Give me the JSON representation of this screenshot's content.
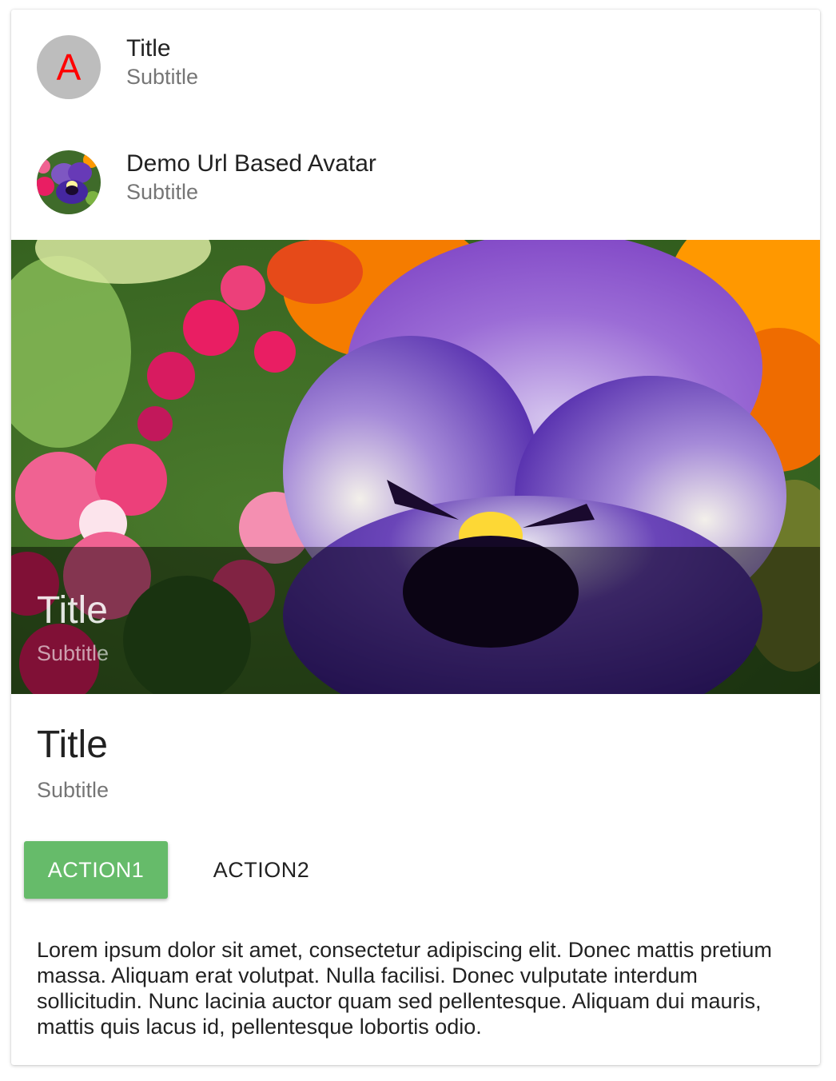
{
  "headers": [
    {
      "avatar_letter": "A",
      "avatar_letter_color": "#ff0000",
      "avatar_background": "#bdbdbd",
      "title": "Title",
      "subtitle": "Subtitle"
    },
    {
      "avatar_image": "pansy-flower-photo",
      "title": "Demo Url Based Avatar",
      "subtitle": "Subtitle"
    }
  ],
  "media": {
    "image": "purple-pansy-flower-photo",
    "overlay_title": "Title",
    "overlay_subtitle": "Subtitle"
  },
  "card_title": {
    "title": "Title",
    "subtitle": "Subtitle"
  },
  "actions": {
    "action1_label": "ACTION1",
    "action2_label": "ACTION2",
    "action1_color": "#66bb6a"
  },
  "text": "Lorem ipsum dolor sit amet, consectetur adipiscing elit. Donec mattis pretium massa. Aliquam erat volutpat. Nulla facilisi. Donec vulputate interdum sollicitudin. Nunc lacinia auctor quam sed pellentesque. Aliquam dui mauris, mattis quis lacus id, pellentesque lobortis odio."
}
